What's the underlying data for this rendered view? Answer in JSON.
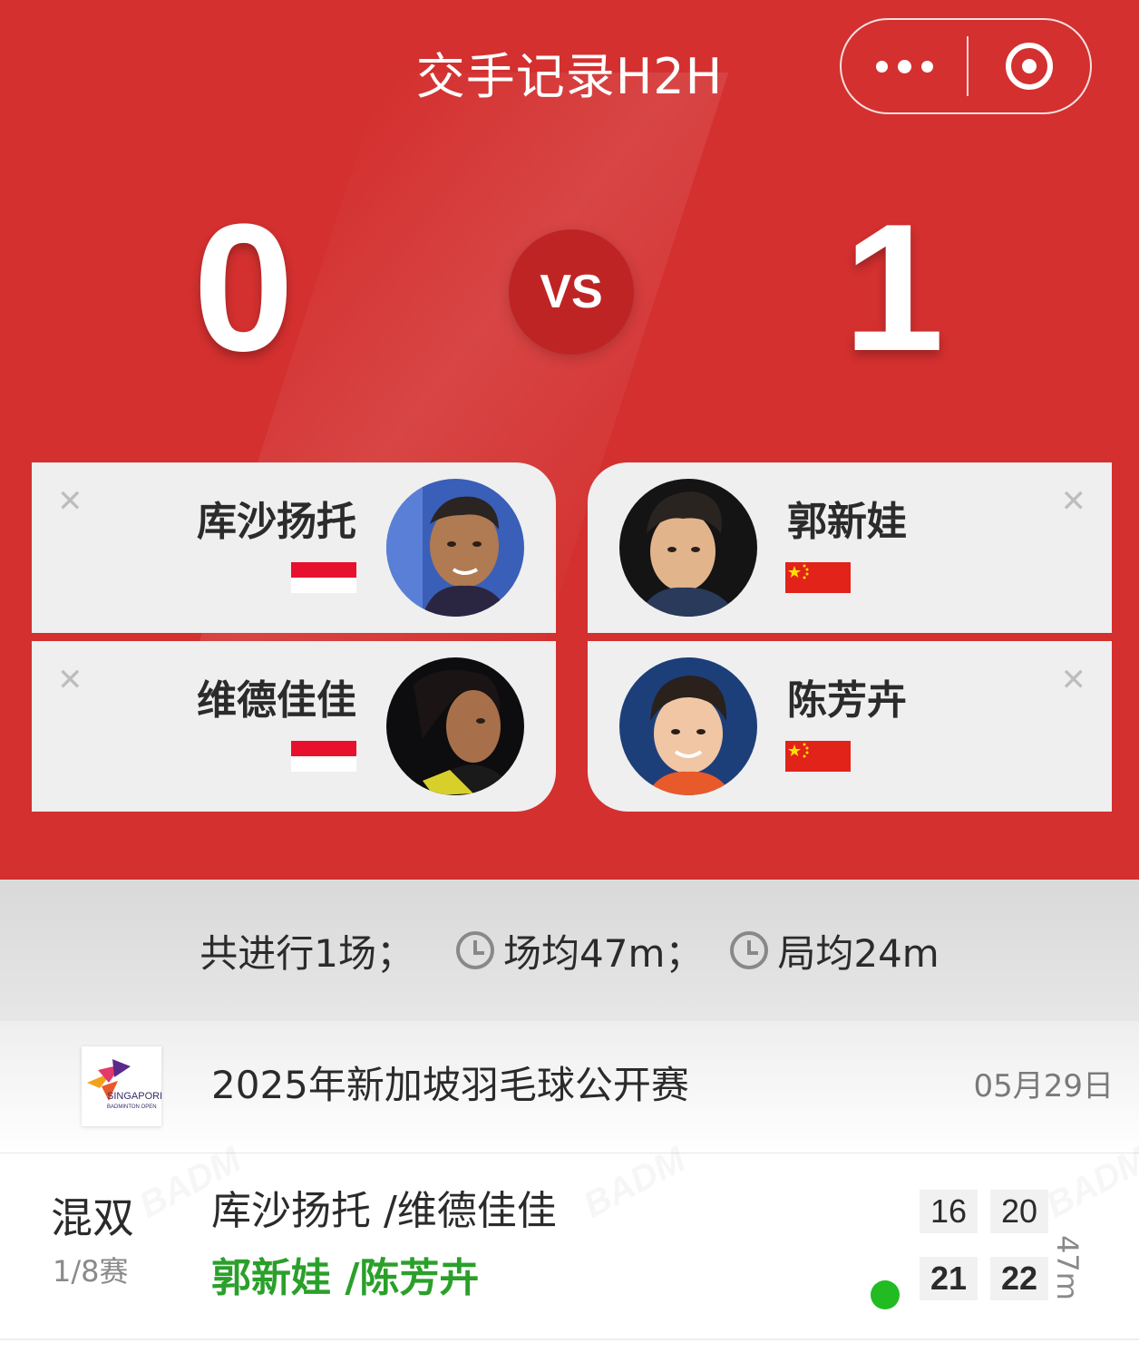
{
  "header": {
    "title": "交手记录H2H",
    "menu_icon": "more-dots-icon",
    "close_icon": "close-target-icon"
  },
  "scoreboard": {
    "left_score": "0",
    "vs_label": "VS",
    "right_score": "1"
  },
  "teams": {
    "left": [
      {
        "name": "库沙扬托",
        "country_flag": "indonesia-flag",
        "remove_icon": "close-icon"
      },
      {
        "name": "维德佳佳",
        "country_flag": "indonesia-flag",
        "remove_icon": "close-icon"
      }
    ],
    "right": [
      {
        "name": "郭新娃",
        "country_flag": "china-flag",
        "remove_icon": "close-icon"
      },
      {
        "name": "陈芳卉",
        "country_flag": "china-flag",
        "remove_icon": "close-icon"
      }
    ]
  },
  "summary": {
    "total": "共进行1场；",
    "avg_match": "场均47m；",
    "avg_game": "局均24m"
  },
  "matches": [
    {
      "tournament": "2025年新加坡羽毛球公开赛",
      "logo_text_1": "SINGAPORE",
      "logo_text_2": "BADMINTON OPEN",
      "date": "05月29日",
      "event": "混双",
      "round": "1/8赛",
      "team1": "库沙扬托 /维德佳佳",
      "team2": "郭新娃 /陈芳卉",
      "team1_scores": [
        "16",
        "20"
      ],
      "team2_scores": [
        "21",
        "22"
      ],
      "winner": "team2",
      "duration": "47m"
    }
  ],
  "colors": {
    "primary_red": "#d3302f",
    "vs_red": "#bf2424",
    "winner_green": "#2aa02a"
  }
}
